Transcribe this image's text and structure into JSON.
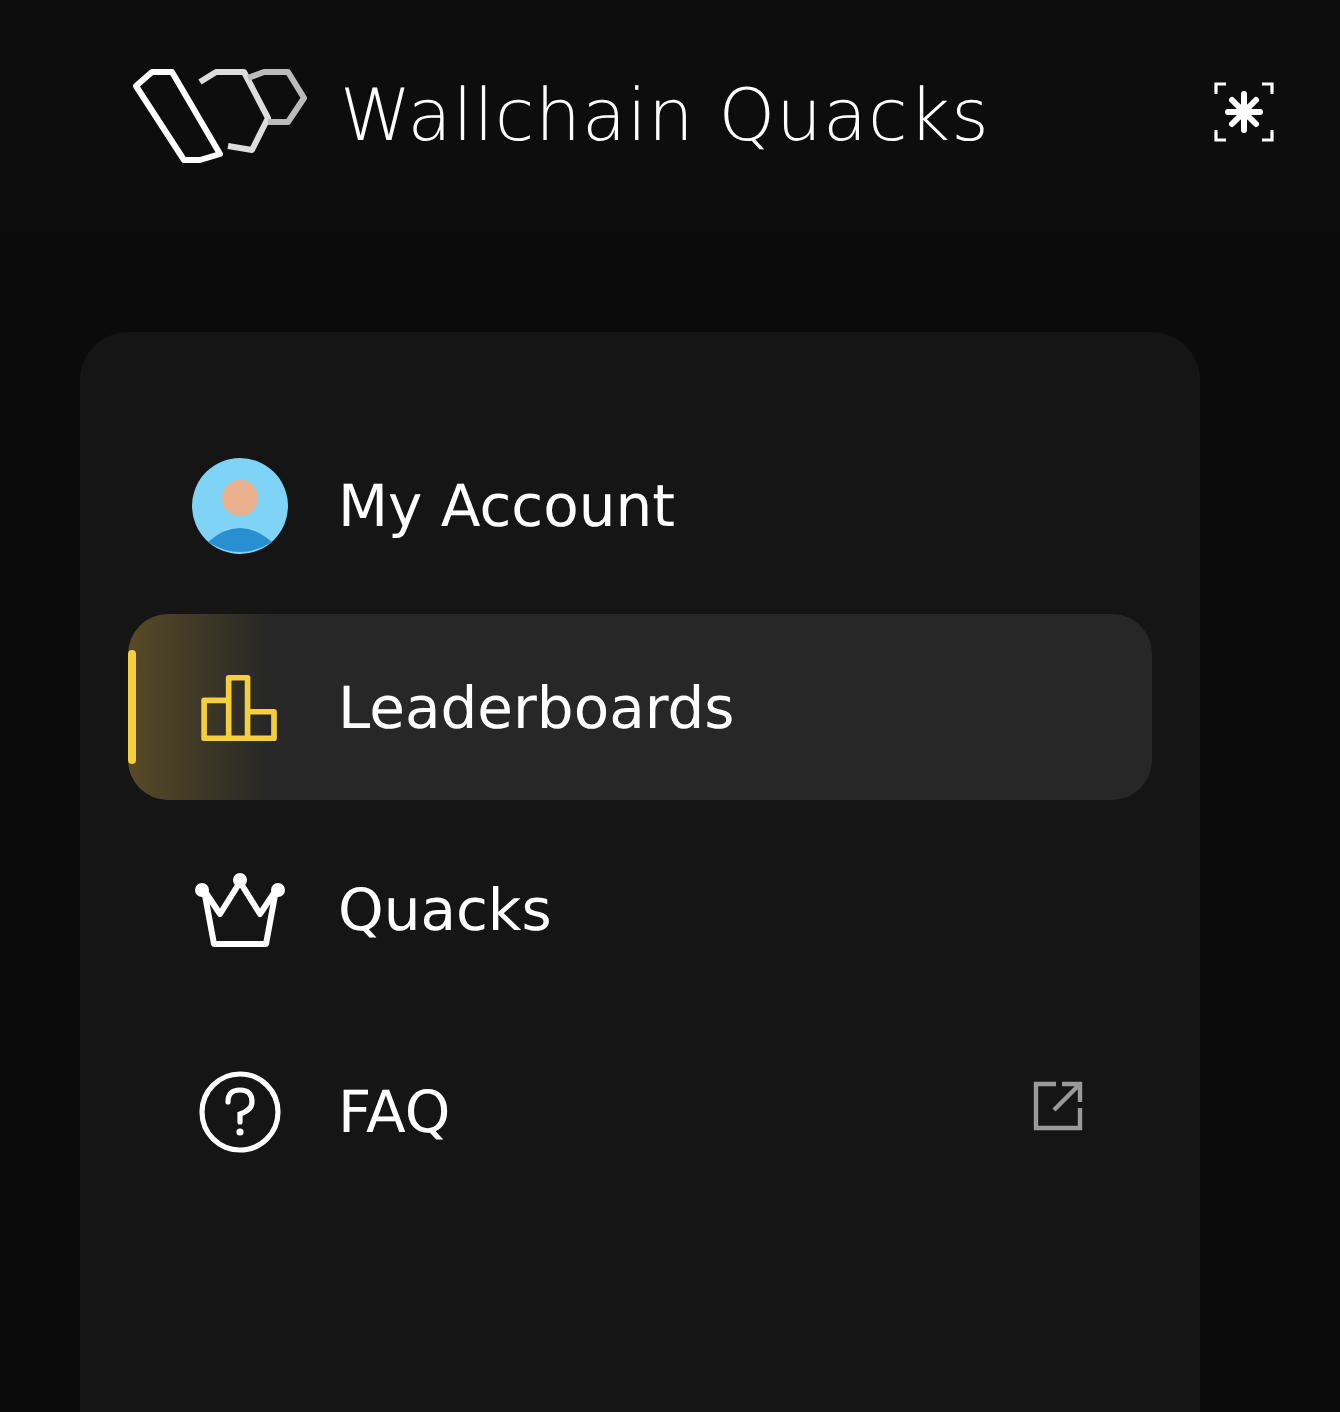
{
  "header": {
    "brand": "Wallchain Quacks"
  },
  "menu": {
    "items": [
      {
        "kind": "avatar",
        "label": "My Account",
        "selected": false,
        "external": false
      },
      {
        "kind": "leaderboard",
        "label": "Leaderboards",
        "selected": true,
        "external": false
      },
      {
        "kind": "crown",
        "label": "Quacks",
        "selected": false,
        "external": false
      },
      {
        "kind": "help",
        "label": "FAQ",
        "selected": false,
        "external": true
      }
    ]
  }
}
